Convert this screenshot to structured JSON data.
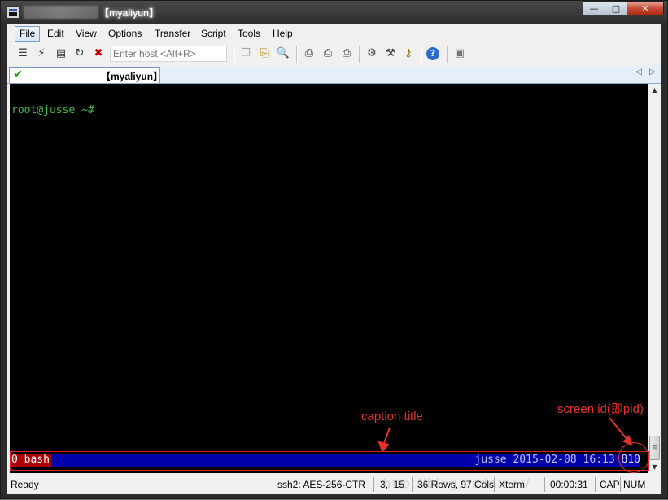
{
  "window": {
    "title": "【myaliyun】",
    "controls": {
      "minimize": "—",
      "maximize": "□",
      "close": "✕"
    }
  },
  "menu": {
    "items": [
      "File",
      "Edit",
      "View",
      "Options",
      "Transfer",
      "Script",
      "Tools",
      "Help"
    ],
    "active_index": 0
  },
  "toolbar": {
    "host_placeholder": "Enter host <Alt+R>",
    "icons": [
      "connect-icon",
      "quick-connect-icon",
      "connect-in-tab-icon",
      "reconnect-icon",
      "disconnect-icon",
      "copy-icon",
      "paste-icon",
      "find-icon",
      "print-setup-icon",
      "print-screen-icon",
      "print-icon",
      "session-options-icon",
      "global-options-icon",
      "keymap-icon",
      "help-icon",
      "sftp-icon"
    ]
  },
  "tabs": [
    {
      "label": "【myaliyun】",
      "status_icon": "check-icon"
    }
  ],
  "terminal": {
    "prompt": "root@jusse ~#",
    "caption_left": "0 bash",
    "caption_right": "jusse 2015-02-08 16:13",
    "screen_id": "810",
    "colors": {
      "background": "#000000",
      "prompt": "#3fbf3f",
      "caption_bg": "#0000aa",
      "caption_left_bg": "#aa0000"
    }
  },
  "statusbar": {
    "ready": "Ready",
    "cipher": "ssh2: AES-256-CTR",
    "cursor": "3,  15",
    "size": "36 Rows, 97 Cols",
    "term": "Xterm",
    "time": "00:00:31",
    "cap": "CAP",
    "num": "NUM"
  },
  "annotations": {
    "caption_title": "caption title",
    "screen_id": "screen id(即pid)",
    "color": "#e8302a"
  },
  "watermark": "http://blog.csdn.net/"
}
